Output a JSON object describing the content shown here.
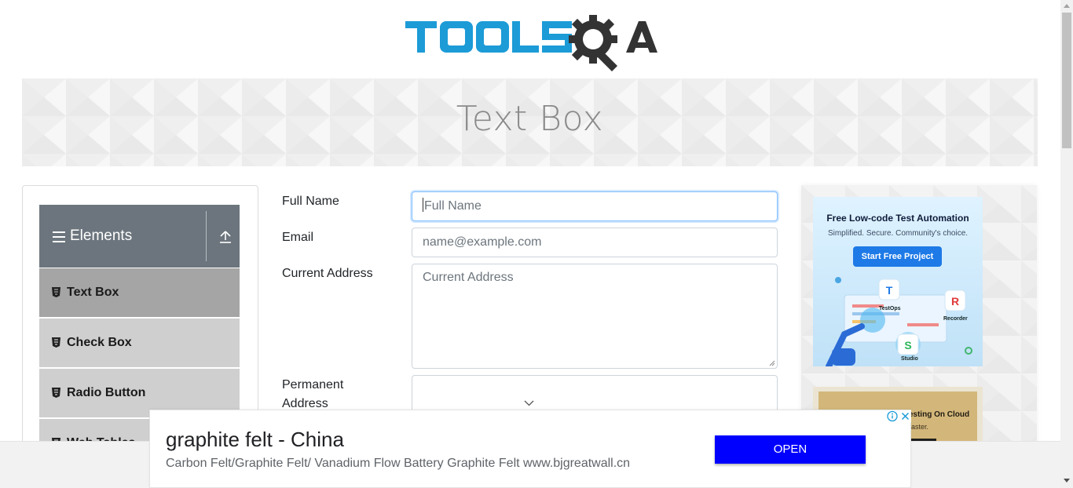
{
  "header": {
    "logo_text": "TOOLSQA"
  },
  "banner": {
    "title": "Text Box"
  },
  "sidebar": {
    "group": {
      "title": "Elements"
    },
    "items": [
      {
        "label": "Text Box"
      },
      {
        "label": "Check Box"
      },
      {
        "label": "Radio Button"
      },
      {
        "label": "Web Tables"
      }
    ]
  },
  "form": {
    "full_name": {
      "label": "Full Name",
      "placeholder": "Full Name",
      "value": ""
    },
    "email": {
      "label": "Email",
      "placeholder": "name@example.com",
      "value": ""
    },
    "current_address": {
      "label": "Current Address",
      "placeholder": "Current Address",
      "value": ""
    },
    "permanent_address": {
      "label_line1": "Permanent",
      "label_line2": "Address",
      "value": ""
    }
  },
  "right_ad": {
    "headline": "Free Low-code Test Automation",
    "subline": "Simplified. Secure. Community's choice.",
    "button": "Start Free Project",
    "labels": {
      "testops": "TestOps",
      "recorder": "Recorder",
      "studio": "Studio"
    },
    "second_headline": "Selenium & Cypress Testing On Cloud",
    "second_subline": "... Ship Faster."
  },
  "bottom_ad": {
    "headline": "graphite felt - China",
    "description": "Carbon Felt/Graphite Felt/ Vanadium Flow Battery Graphite Felt www.bjgreatwall.cn",
    "button": "OPEN"
  },
  "colors": {
    "logo_blue": "#1c9bd7",
    "logo_dark": "#333333",
    "sidebar_header": "#6c757d",
    "sidebar_active": "#a5a5a5",
    "sidebar_item": "#cfcfcf",
    "ad_button": "#0000ff",
    "focus_border": "#80bdff"
  }
}
